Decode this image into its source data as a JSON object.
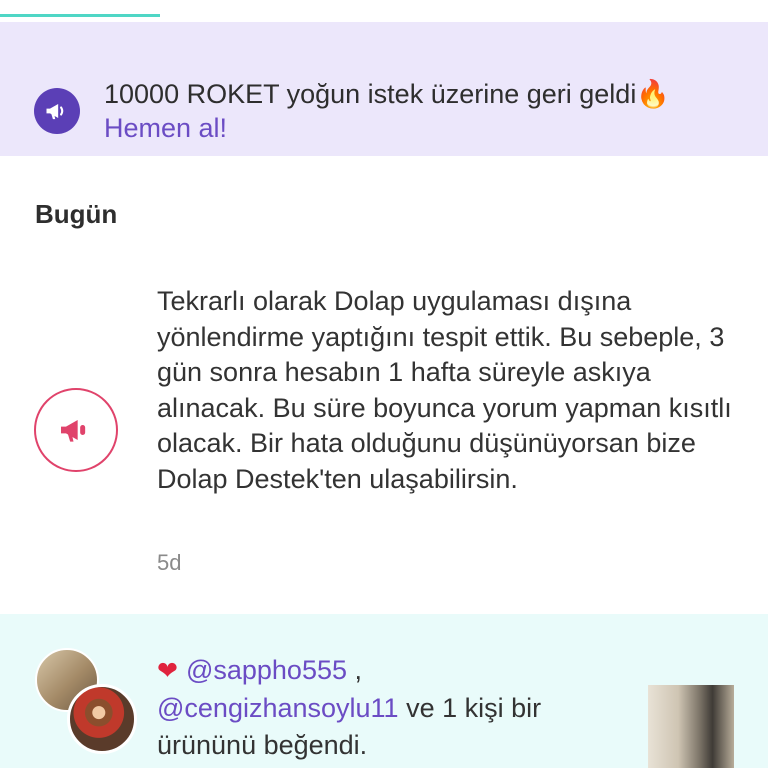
{
  "promo": {
    "message": "10000 ROKET yoğun istek üzerine geri geldi🔥",
    "cta": "Hemen al!",
    "accent_color": "#5b3fb6",
    "icon": "megaphone-icon"
  },
  "section": {
    "title": "Bugün"
  },
  "notification": {
    "message": "Tekrarlı olarak Dolap uygulaması dışına yönlendirme yaptığını tespit ettik. Bu sebeple, 3 gün sonra hesabın 1 hafta süreyle askıya alınacak. Bu süre boyunca yorum yapman kısıtlı olacak. Bir hata olduğunu düşünüyorsan bize Dolap Destek'ten ulaşabilirsin.",
    "time": "5d",
    "accent_color": "#e0436b",
    "icon": "megaphone-icon"
  },
  "like_activity": {
    "heart": "❤",
    "user1": "@sappho555",
    "separator": " ,",
    "user2": "@cengizhansoylu11",
    "suffix": " ve 1 kişi bir ürününü beğendi."
  }
}
